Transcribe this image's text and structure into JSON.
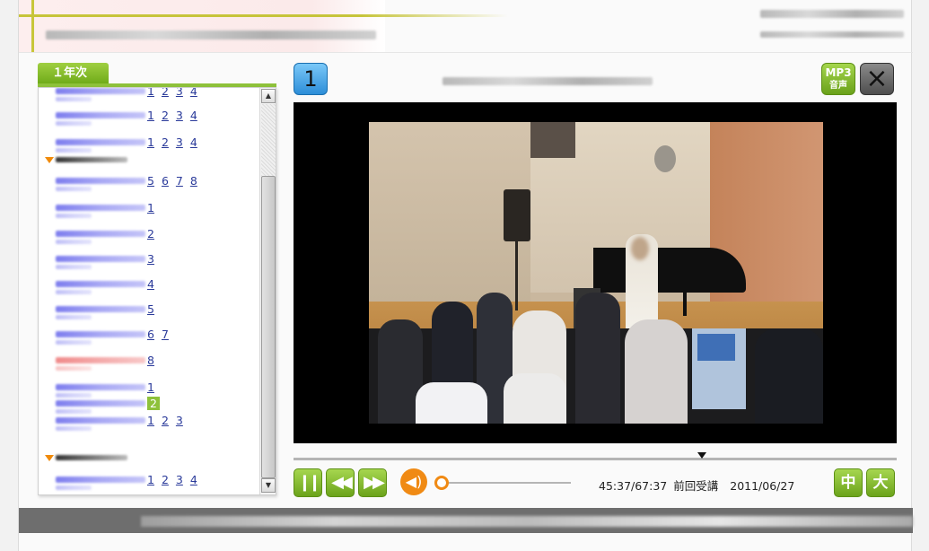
{
  "sidebar": {
    "year_tab": "１年次",
    "items": [
      {
        "nums": [
          "1",
          "2",
          "3",
          "4"
        ],
        "type": "normal"
      },
      {
        "nums": [
          "1",
          "2",
          "3",
          "4"
        ],
        "type": "normal"
      },
      {
        "nums": [
          "1",
          "2",
          "3",
          "4"
        ],
        "type": "normal"
      },
      {
        "nums": [
          "5",
          "6",
          "7",
          "8"
        ],
        "type": "normal"
      },
      {
        "nums": [
          "1"
        ],
        "type": "normal"
      },
      {
        "nums": [
          "2"
        ],
        "type": "normal"
      },
      {
        "nums": [
          "3"
        ],
        "type": "normal"
      },
      {
        "nums": [
          "4"
        ],
        "type": "normal"
      },
      {
        "nums": [
          "5"
        ],
        "type": "normal"
      },
      {
        "nums": [
          "6",
          "7"
        ],
        "type": "normal"
      },
      {
        "nums": [
          "8"
        ],
        "type": "red"
      },
      {
        "nums": [
          "1"
        ],
        "type": "normal"
      },
      {
        "nums": [
          "2"
        ],
        "type": "active"
      },
      {
        "nums": [
          "1",
          "2",
          "3"
        ],
        "type": "normal"
      },
      {
        "nums": [
          "1",
          "2",
          "3",
          "4"
        ],
        "type": "normal"
      }
    ]
  },
  "player": {
    "chapter_number": "1",
    "mp3_label_top": "MP3",
    "mp3_label_bottom": "音声",
    "close_icon": "×",
    "current_time": "45:37/67:37",
    "last_watched_label": "前回受講",
    "last_watched_date": "2011/06/27",
    "size_medium": "中",
    "size_large": "大",
    "volume_icon": "speaker-icon",
    "accent_color": "#8ec13a",
    "orange_color": "#f08a14"
  }
}
